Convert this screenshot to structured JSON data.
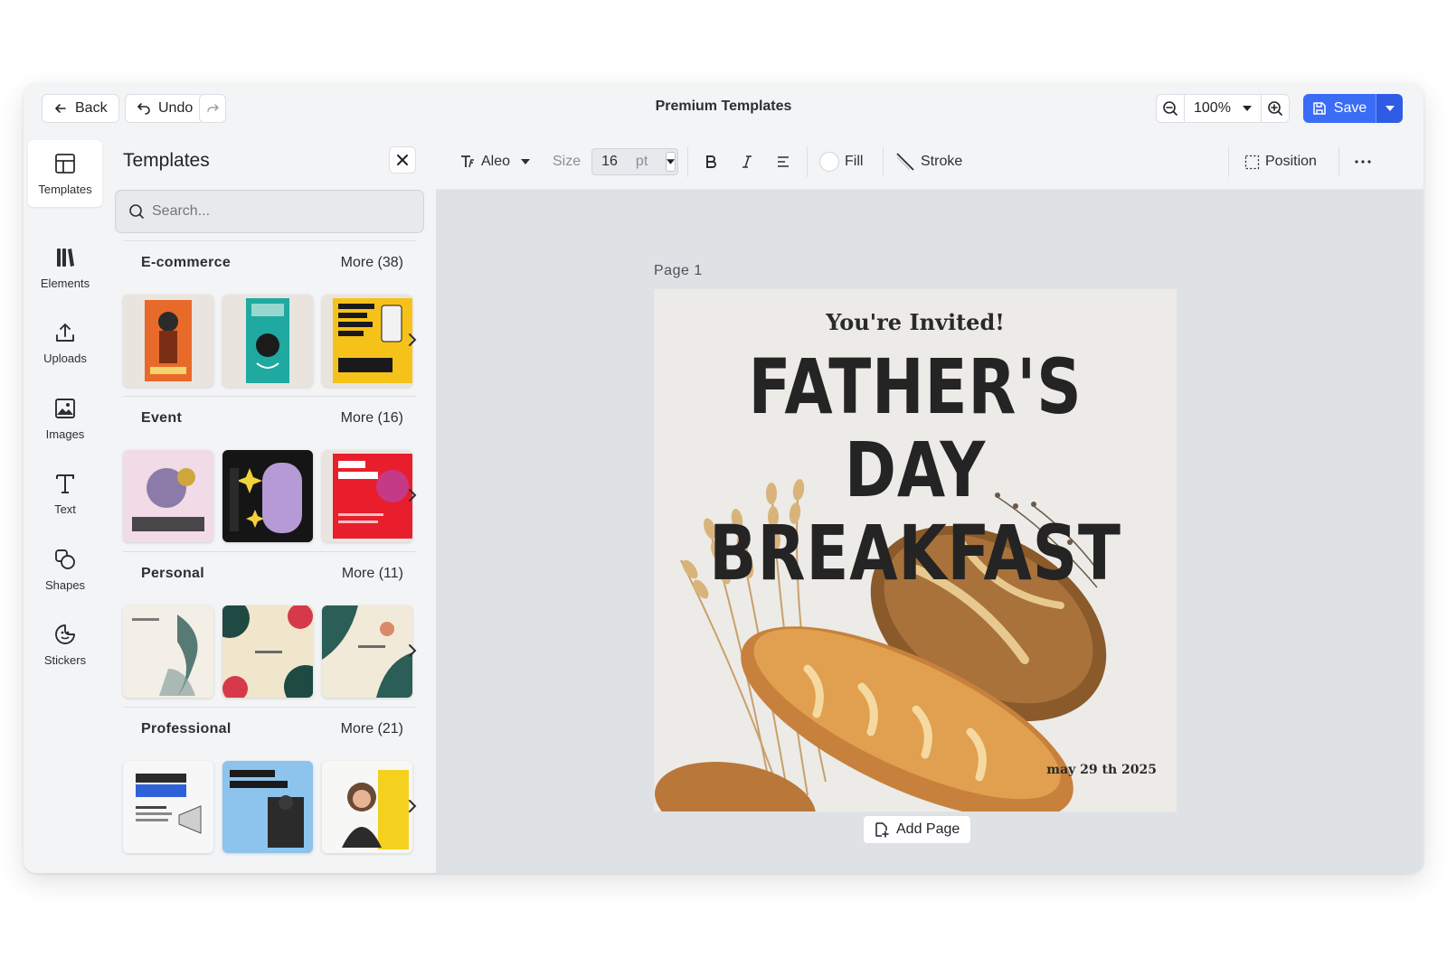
{
  "topbar": {
    "back_label": "Back",
    "undo_label": "Undo",
    "title": "Premium Templates",
    "zoom": "100%",
    "save_label": "Save"
  },
  "rail": {
    "items": [
      {
        "label": "Templates",
        "icon": "layout-icon"
      },
      {
        "label": "Elements",
        "icon": "elements-icon"
      },
      {
        "label": "Uploads",
        "icon": "upload-icon"
      },
      {
        "label": "Images",
        "icon": "image-icon"
      },
      {
        "label": "Text",
        "icon": "text-icon"
      },
      {
        "label": "Shapes",
        "icon": "shapes-icon"
      },
      {
        "label": "Stickers",
        "icon": "sticker-icon"
      }
    ]
  },
  "panel": {
    "title": "Templates",
    "search_placeholder": "Search...",
    "sections": [
      {
        "name": "E-commerce",
        "more": "More (38)"
      },
      {
        "name": "Event",
        "more": "More (16)"
      },
      {
        "name": "Personal",
        "more": "More (11)"
      },
      {
        "name": "Professional",
        "more": "More (21)"
      }
    ]
  },
  "format": {
    "font": "Aleo",
    "size_label": "Size",
    "size_value": "16",
    "size_unit": "pt",
    "fill_label": "Fill",
    "stroke_label": "Stroke",
    "position_label": "Position"
  },
  "canvas": {
    "page_label": "Page  1",
    "invite": "You're Invited!",
    "headline_1": "FATHER'S DAY",
    "headline_2": "BREAKFAST",
    "date": "may 29 th 2025",
    "add_page_label": "Add Page"
  },
  "colors": {
    "accent": "#3b6cf6",
    "app_bg": "#f3f4f6",
    "canvas_bg": "#dfe2e5"
  }
}
